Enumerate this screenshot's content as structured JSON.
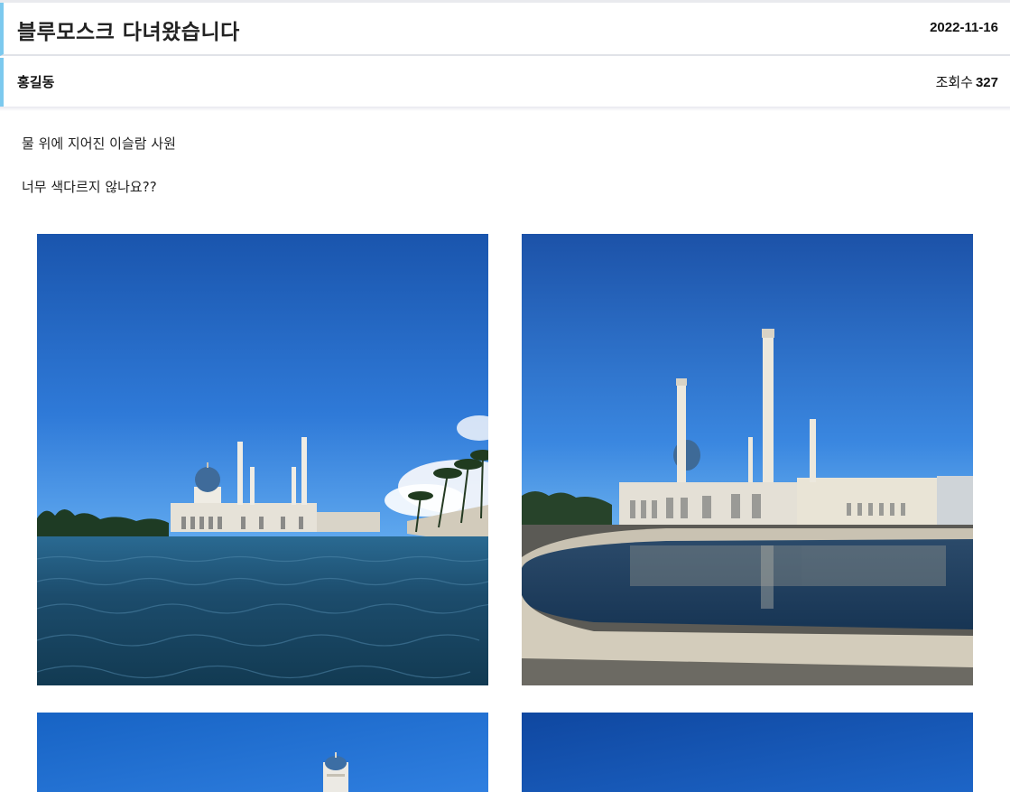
{
  "post": {
    "title": "블루모스크 다녀왔습니다",
    "date": "2022-11-16",
    "author": "홍길동",
    "views_label": "조회수",
    "views_count": "327",
    "paragraphs": [
      "물 위에 지어진 이슬람 사원",
      "너무 색다르지 않나요??"
    ]
  },
  "photos": [
    {
      "subject": "mosque-on-water-wide"
    },
    {
      "subject": "mosque-reflection-pool"
    },
    {
      "subject": "mosque-minaret-sky"
    },
    {
      "subject": "blue-sky"
    }
  ],
  "colors": {
    "accent_bar": "#7cc9ee",
    "sky_top": "#1a57b0",
    "sky_bottom": "#4a93e4",
    "water": "#1f4e6e"
  }
}
